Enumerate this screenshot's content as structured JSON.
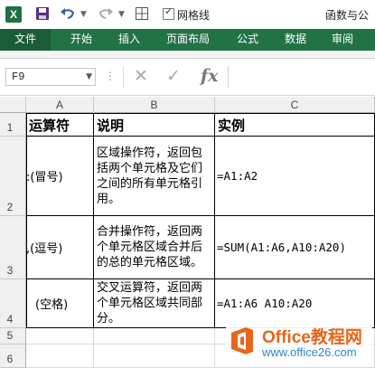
{
  "titlebar": {
    "app_icon": "excel-logo-icon",
    "app_letter": "X",
    "save_icon": "save-icon",
    "undo_icon": "undo-icon",
    "redo_icon": "redo-icon",
    "table_icon": "border-table-icon",
    "gridlines_label": "网格线",
    "gridlines_checked": true,
    "window_title": "函数与公"
  },
  "ribbon": {
    "tabs": [
      "文件",
      "开始",
      "插入",
      "页面布局",
      "公式",
      "数据",
      "审阅"
    ]
  },
  "formula_bar": {
    "name_box": "F9",
    "cancel_icon": "cancel-x-icon",
    "enter_icon": "enter-check-icon",
    "fx_label": "fx",
    "formula": ""
  },
  "sheet": {
    "columns": [
      "A",
      "B",
      "C"
    ],
    "rows": [
      "1",
      "2",
      "3",
      "4",
      "5",
      "6"
    ],
    "header_row": [
      "运算符",
      "说明",
      "实例"
    ],
    "data_rows": [
      {
        "a": ":(冒号)",
        "b": "区域操作符，返回包括两个单元格及它们之间的所有单元格引用。",
        "c": "=A1:A2"
      },
      {
        "a": ",(逗号)",
        "b": "合并操作符，返回两个单元格区域合并后的总的单元格区域。",
        "c": "=SUM(A1:A6,A10:A20)"
      },
      {
        "a": "(空格)",
        "b": "交叉运算符，返回两个单元格区域共同部分。",
        "c": "=A1:A6 A10:A20"
      }
    ]
  },
  "watermark": {
    "brand": "Office教程网",
    "url": "www.office26.com"
  },
  "colors": {
    "ribbon_green": "#217346",
    "file_tab": "#1a5c38",
    "watermark_orange": "#e8651a",
    "watermark_blue": "#2a86c8"
  }
}
